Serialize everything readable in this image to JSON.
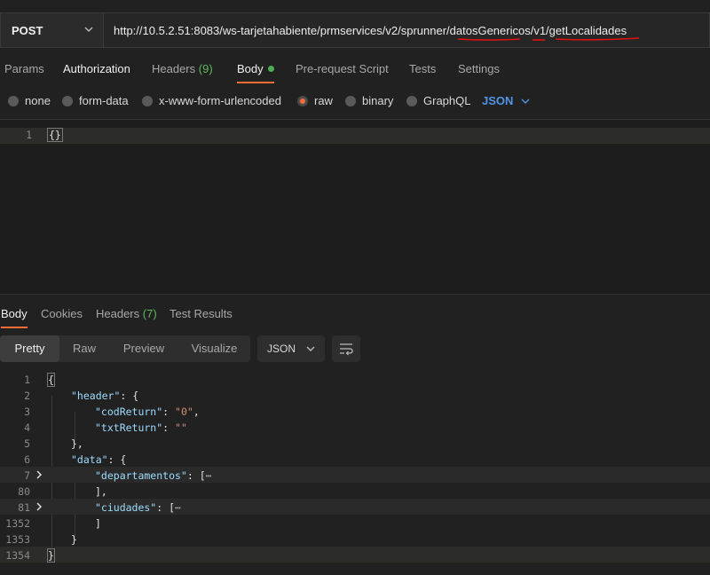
{
  "request": {
    "method": "POST",
    "url": "http://10.5.2.51:8083/ws-tarjetahabiente/prmservices/v2/sprunner/datosGenericos/v1/getLocalidades"
  },
  "request_tabs": [
    {
      "label": "Params"
    },
    {
      "label": "Authorization"
    },
    {
      "label": "Headers",
      "count": "(9)"
    },
    {
      "label": "Body",
      "active": true
    },
    {
      "label": "Pre-request Script"
    },
    {
      "label": "Tests"
    },
    {
      "label": "Settings"
    }
  ],
  "body_types": {
    "options": [
      "none",
      "form-data",
      "x-www-form-urlencoded",
      "raw",
      "binary",
      "GraphQL"
    ],
    "selected": "raw",
    "language": "JSON"
  },
  "request_editor": {
    "line_number": "1",
    "content": "{}"
  },
  "response_tabs": [
    {
      "label": "Body",
      "active": true
    },
    {
      "label": "Cookies"
    },
    {
      "label": "Headers",
      "count": "(7)"
    },
    {
      "label": "Test Results"
    }
  ],
  "response_toolbar": {
    "views": [
      "Pretty",
      "Raw",
      "Preview",
      "Visualize"
    ],
    "active_view": "Pretty",
    "format": "JSON"
  },
  "response_lines": [
    {
      "n": "1"
    },
    {
      "n": "2",
      "key": "\"header\"",
      "after": ": {"
    },
    {
      "n": "3",
      "key": "\"codReturn\"",
      "val": "\"0\"",
      "tail": ","
    },
    {
      "n": "4",
      "key": "\"txtReturn\"",
      "val": "\"\""
    },
    {
      "n": "5",
      "text": "},"
    },
    {
      "n": "6",
      "key": "\"data\"",
      "after": ": {"
    },
    {
      "n": "7",
      "key": "\"departamentos\"",
      "after": ": [",
      "collapsed": "⋯"
    },
    {
      "n": "80",
      "text": "],"
    },
    {
      "n": "81",
      "key": "\"ciudades\"",
      "after": ": [",
      "collapsed": "⋯"
    },
    {
      "n": "1352",
      "text": "]"
    },
    {
      "n": "1353",
      "text": "}"
    },
    {
      "n": "1354"
    }
  ],
  "colors": {
    "accent": "#ff6c37",
    "json_key": "#9cdcfe",
    "json_string": "#ce9178",
    "link_blue": "#4f95e8",
    "count_green": "#5fb85f"
  }
}
